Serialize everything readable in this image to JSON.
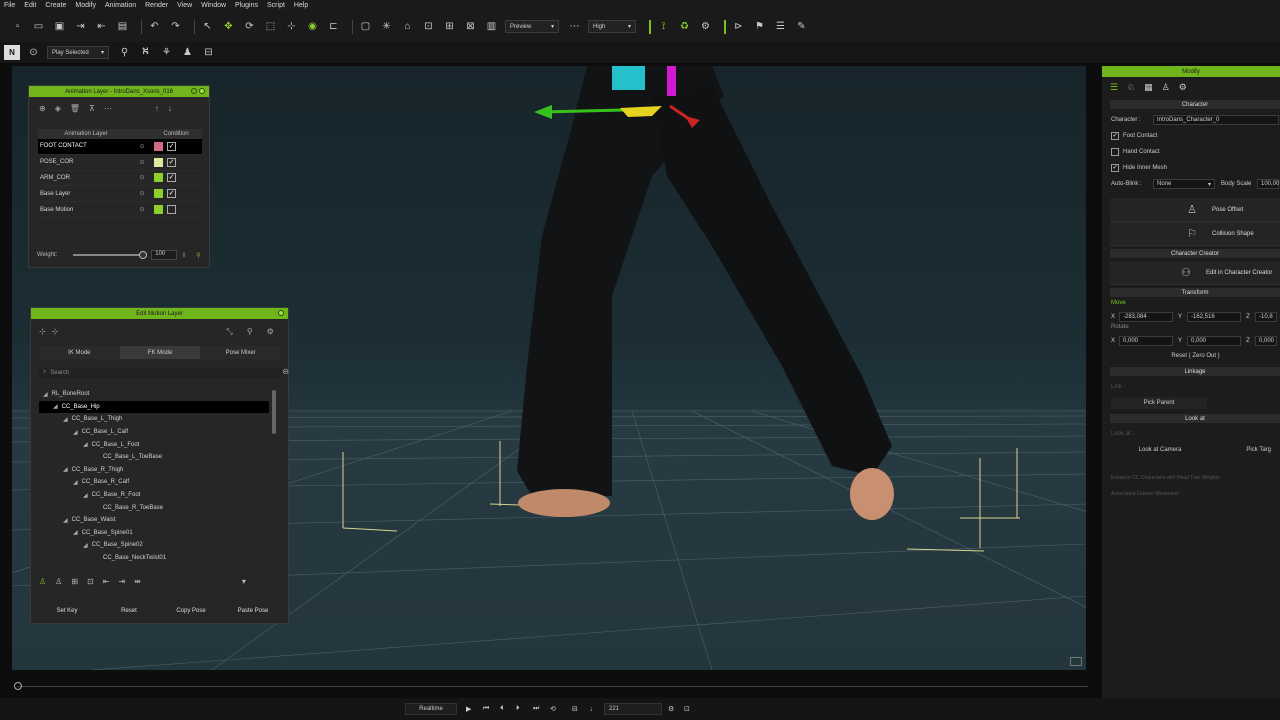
{
  "menu": [
    "File",
    "Edit",
    "Create",
    "Modify",
    "Animation",
    "Render",
    "View",
    "Window",
    "Plugins",
    "Script",
    "Help"
  ],
  "toolbar": {
    "preview_label": "Preview",
    "quality_label": "High",
    "play_selected_label": "Play Selected"
  },
  "anim_layer": {
    "title": "Animation Layer - IntroDans_Xsons_016",
    "col_layer": "Animation Layer",
    "col_condition": "Condition",
    "rows": [
      {
        "name": "FOOT CONTACT",
        "color": "#d46a86",
        "checked": true,
        "selected": true
      },
      {
        "name": "POSE_COR",
        "color": "#e3e8a0",
        "checked": true,
        "selected": false
      },
      {
        "name": "ARM_COR",
        "color": "#8ccf2a",
        "checked": true,
        "selected": false
      },
      {
        "name": "Base Layer",
        "color": "#8ccf2a",
        "checked": true,
        "selected": false
      },
      {
        "name": "Base Motion",
        "color": "#8ccf2a",
        "checked": false,
        "selected": false
      }
    ],
    "weight_label": "Weight:",
    "weight_value": "100"
  },
  "edit_motion": {
    "title": "Edit Motion Layer",
    "modes": [
      "IK Mode",
      "FK Mode",
      "Pose Mixer"
    ],
    "active_mode": "FK Mode",
    "search_placeholder": "Search",
    "tree": [
      {
        "label": "RL_BoneRoot",
        "depth": 0
      },
      {
        "label": "CC_Base_Hip",
        "depth": 1,
        "selected": true
      },
      {
        "label": "CC_Base_L_Thigh",
        "depth": 2
      },
      {
        "label": "CC_Base_L_Calf",
        "depth": 3
      },
      {
        "label": "CC_Base_L_Foot",
        "depth": 4
      },
      {
        "label": "CC_Base_L_ToeBase",
        "depth": 5
      },
      {
        "label": "CC_Base_R_Thigh",
        "depth": 2
      },
      {
        "label": "CC_Base_R_Calf",
        "depth": 3
      },
      {
        "label": "CC_Base_R_Foot",
        "depth": 4
      },
      {
        "label": "CC_Base_R_ToeBase",
        "depth": 5
      },
      {
        "label": "CC_Base_Waist",
        "depth": 2
      },
      {
        "label": "CC_Base_Spine01",
        "depth": 3
      },
      {
        "label": "CC_Base_Spine02",
        "depth": 4
      },
      {
        "label": "CC_Base_NeckTwist01",
        "depth": 5
      }
    ],
    "buttons": [
      "Set Key",
      "Reset",
      "Copy Pose",
      "Paste Pose"
    ]
  },
  "modify": {
    "title": "Modify",
    "section_character": "Character",
    "character_label": "Character :",
    "character_value": "IntroDans_Character_0",
    "foot_contact": "Foot Contact",
    "hand_contact": "Hand Contact",
    "hide_inner_mesh": "Hide Inner Mesh",
    "auto_blink_label": "Auto-Blink :",
    "auto_blink_value": "None",
    "body_scale_label": "Body Scale",
    "body_scale_value": "100,00",
    "pose_offset": "Pose Offset",
    "collision_shape": "Collision Shape",
    "section_cc": "Character Creator",
    "edit_in_cc": "Edit in Character Creator",
    "section_transform": "Transform",
    "move_label": "Move",
    "move_x": "-283,084",
    "move_y": "-162,516",
    "move_z": "-10,8",
    "rotate_label": "Rotate",
    "rot_x": "0,000",
    "rot_y": "0,000",
    "rot_z": "0,000",
    "reset_zero": "Reset ( Zero Out )",
    "section_linkage": "Linkage",
    "link_label": "Link :",
    "pick_parent": "Pick Parent",
    "section_lookat": "Look at",
    "look_at_label": "Look at :",
    "look_at_camera": "Look at Camera",
    "pick_target": "Pick Targ",
    "enhance_cc": "Enhance CC Characters with Head Turn Weights",
    "associated": "Associated Exterior Movement"
  },
  "playbar": {
    "mode": "Realtime",
    "frame": "221"
  }
}
